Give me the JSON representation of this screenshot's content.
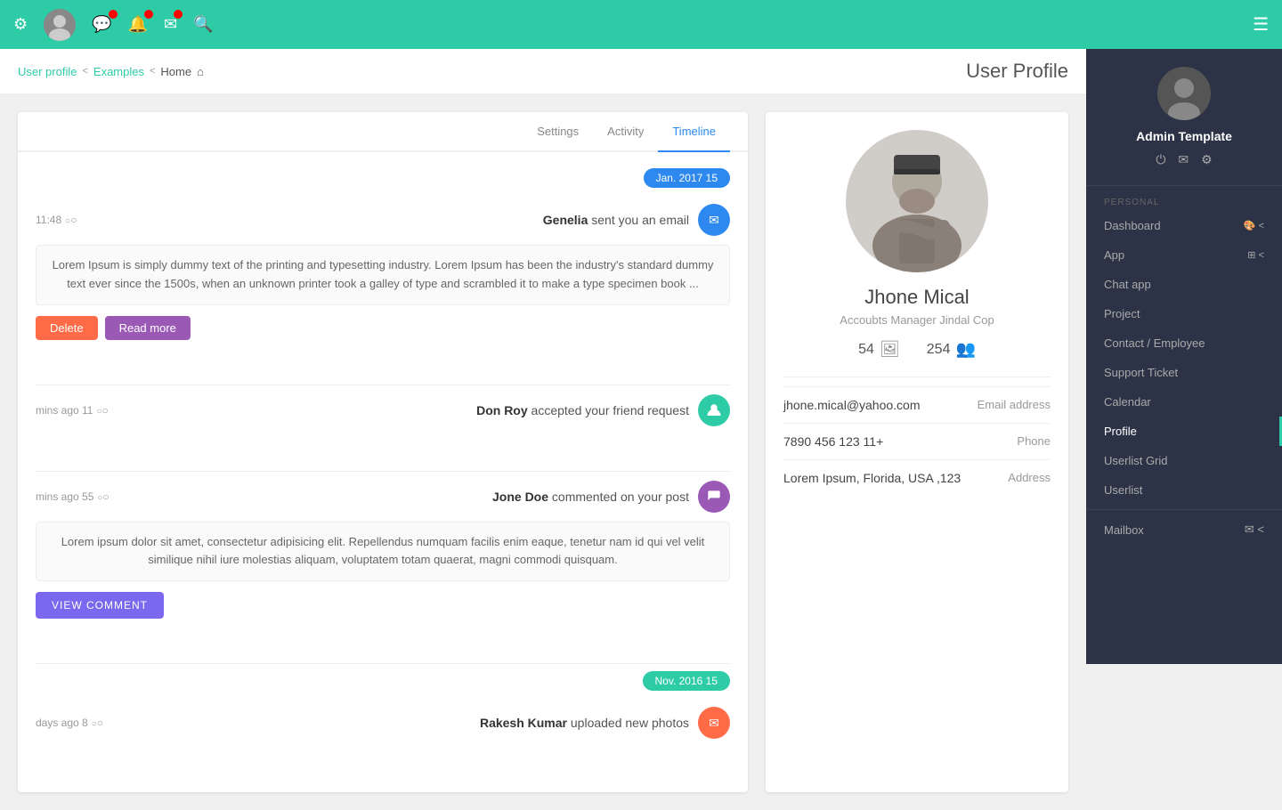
{
  "topbar": {
    "icons": [
      "gear",
      "avatar",
      "chat",
      "bell",
      "mail",
      "search"
    ]
  },
  "right_sidebar": {
    "hamburger": "☰",
    "brand": {
      "name": "Admin Template",
      "subtitle": ""
    },
    "icons": [
      "power",
      "mail",
      "gear"
    ],
    "sections": [
      {
        "label": "PERSONAL",
        "items": [
          {
            "id": "dashboard",
            "label": "Dashboard",
            "icon": "🎨",
            "collapsible": true,
            "chevron": "<"
          },
          {
            "id": "app",
            "label": "App",
            "icon": "⊞",
            "collapsible": true,
            "chevron": "<"
          },
          {
            "id": "chat-app",
            "label": "Chat app",
            "indent": true
          },
          {
            "id": "project",
            "label": "Project",
            "indent": true
          },
          {
            "id": "contact-employee",
            "label": "Contact / Employee",
            "indent": true
          },
          {
            "id": "support-ticket",
            "label": "Support Ticket",
            "indent": true
          },
          {
            "id": "calendar",
            "label": "Calendar",
            "indent": true
          },
          {
            "id": "profile",
            "label": "Profile",
            "indent": true,
            "active": true
          },
          {
            "id": "userlist-grid",
            "label": "Userlist Grid",
            "indent": true
          },
          {
            "id": "userlist",
            "label": "Userlist",
            "indent": true
          }
        ]
      },
      {
        "label": "",
        "items": [
          {
            "id": "mailbox",
            "label": "Mailbox",
            "icon": "✉",
            "collapsible": true,
            "chevron": "<"
          }
        ]
      }
    ]
  },
  "breadcrumb": {
    "items": [
      "User profile",
      "Examples",
      "Home"
    ],
    "home_icon": "⌂"
  },
  "page_title": "User Profile",
  "tabs": [
    {
      "id": "settings",
      "label": "Settings"
    },
    {
      "id": "activity",
      "label": "Activity"
    },
    {
      "id": "timeline",
      "label": "Timeline",
      "active": true
    }
  ],
  "timeline": {
    "date_badge_1": "Jan. 2017 15",
    "date_badge_2": "Nov. 2016 15",
    "events": [
      {
        "time": "11:48",
        "user": "Genelia",
        "action": " sent you an email",
        "dot_color": "#2d89ef",
        "dot_icon": "✉",
        "body": "Lorem Ipsum is simply dummy text of the printing and typesetting industry. Lorem Ipsum has been the industry's standard dummy text ever since the 1500s, when an unknown printer took a galley of type and scrambled it to make a type specimen book ...",
        "actions": [
          "Delete",
          "Read more"
        ]
      },
      {
        "time": "mins ago 11",
        "user": "Don Roy",
        "action": " accepted your friend request",
        "dot_color": "#2dcca7",
        "dot_icon": "👤",
        "body": ""
      },
      {
        "time": "mins ago 55",
        "user": "Jone Doe",
        "action": " commented on your post",
        "dot_color": "#9b59b6",
        "dot_icon": "💬",
        "body": "Lorem ipsum dolor sit amet, consectetur adipisicing elit. Repellendus numquam facilis enim eaque, tenetur nam id qui vel velit similique nihil iure molestias aliquam, voluptatem totam quaerat, magni commodi quisquam.",
        "actions": [
          "VIEW COMMENT"
        ]
      },
      {
        "time": "days ago 8",
        "user": "Rakesh Kumar",
        "action": " uploaded new photos",
        "dot_color": "#ff6b47",
        "dot_icon": "✉",
        "body": ""
      }
    ]
  },
  "profile": {
    "name": "Jhone Mical",
    "title": "Accoubts Manager Jindal Cop",
    "photos_count": "54",
    "followers_count": "254",
    "email_label": "Email address",
    "email_value": "jhone.mical@yahoo.com",
    "phone_label": "Phone",
    "phone_value": "7890 456 123 11+",
    "address_label": "Address",
    "address_value": "Lorem Ipsum, Florida, USA ,123"
  }
}
